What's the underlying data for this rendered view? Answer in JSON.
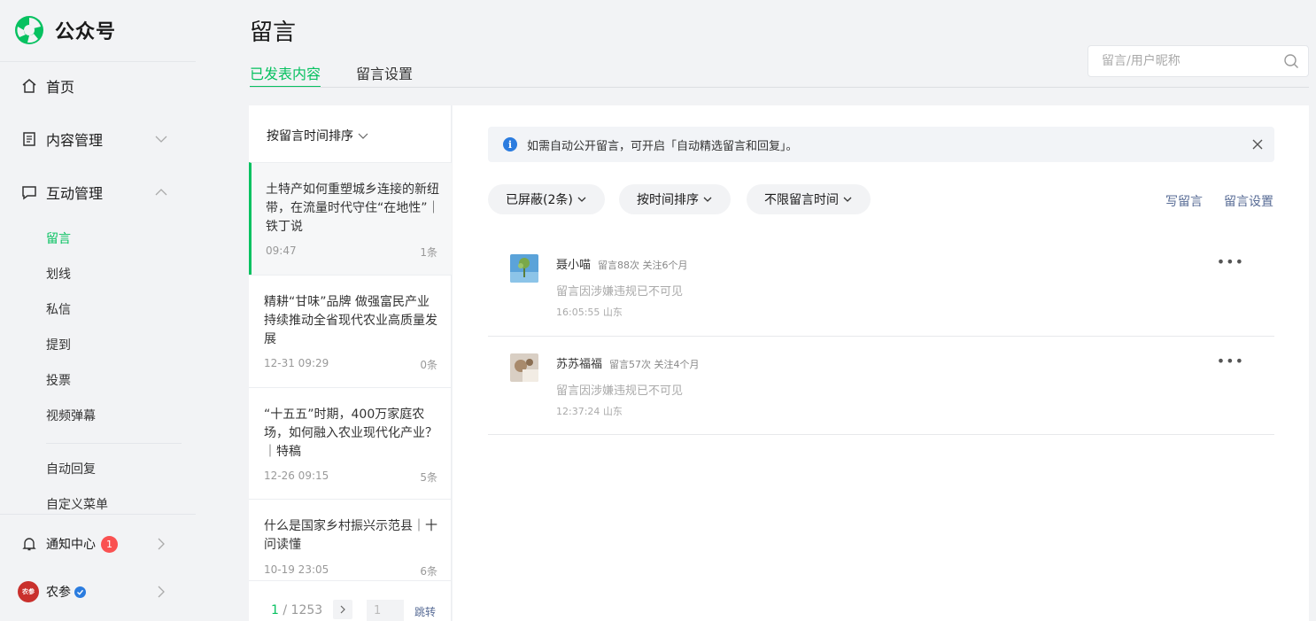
{
  "app": {
    "name": "公众号"
  },
  "sidebar": {
    "home": "首页",
    "content": "内容管理",
    "interaction": "互动管理",
    "sub": [
      "留言",
      "划线",
      "私信",
      "提到",
      "投票",
      "视频弹幕"
    ],
    "sub2": [
      "自动回复",
      "自定义菜单"
    ],
    "notifications": "通知中心",
    "notification_count": "1",
    "account": "农参",
    "account_avatar_text": "农参"
  },
  "page": {
    "title": "留言"
  },
  "tabs": [
    "已发表内容",
    "留言设置"
  ],
  "search": {
    "placeholder": "留言/用户昵称"
  },
  "article_list": {
    "sort_label": "按留言时间排序",
    "items": [
      {
        "title": "土特产如何重塑城乡连接的新纽带，在流量时代守住“在地性”｜铁丁说",
        "date": "09:47",
        "count": "1条"
      },
      {
        "title": "精耕“甘味”品牌 做强富民产业 持续推动全省现代农业高质量发展",
        "date": "12-31 09:29",
        "count": "0条"
      },
      {
        "title": "“十五五”时期，400万家庭农场，如何融入农业现代化产业？｜特稿",
        "date": "12-26 09:15",
        "count": "5条"
      },
      {
        "title": "什么是国家乡村振兴示范县｜十问读懂",
        "date": "10-19 23:05",
        "count": "6条"
      }
    ],
    "pager": {
      "current": "1",
      "separator": "/",
      "total": "1253",
      "jump_value": "1",
      "jump_label": "跳转"
    }
  },
  "notice": {
    "text": "如需自动公开留言，可开启「自动精选留言和回复」。"
  },
  "filters": [
    "已屏蔽(2条)",
    "按时间排序",
    "不限留言时间"
  ],
  "actions": {
    "write": "写留言",
    "settings": "留言设置"
  },
  "comments": [
    {
      "name": "聂小喵",
      "meta": "留言88次 关注6个月",
      "text": "留言因涉嫌违规已不可见",
      "time": "16:05:55 山东"
    },
    {
      "name": "苏苏福福",
      "meta": "留言57次 关注4个月",
      "text": "留言因涉嫌违规已不可见",
      "time": "12:37:24 山东"
    }
  ],
  "colors": {
    "accent": "#07c160",
    "link": "#576b95",
    "badge": "#fa5151",
    "info": "#2b7cdf"
  },
  "icons": [
    "logo-icon",
    "home-icon",
    "document-icon",
    "chat-icon",
    "bell-icon",
    "verified-icon",
    "search-icon",
    "info-icon",
    "close-icon",
    "more-icon"
  ]
}
